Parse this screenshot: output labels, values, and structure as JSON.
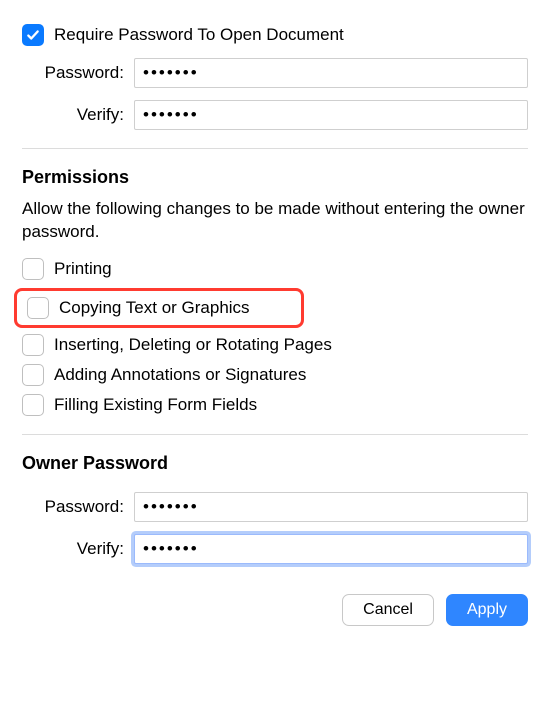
{
  "open_password": {
    "require_label": "Require Password To Open Document",
    "require_checked": true,
    "password_label": "Password:",
    "password_value": "•••••••",
    "verify_label": "Verify:",
    "verify_value": "•••••••"
  },
  "permissions": {
    "title": "Permissions",
    "description": "Allow the following changes to be made without entering the owner password.",
    "items": {
      "printing": "Printing",
      "copying": "Copying Text or Graphics",
      "inserting": "Inserting, Deleting or Rotating Pages",
      "annotations": "Adding Annotations or Signatures",
      "formfields": "Filling Existing Form Fields"
    }
  },
  "owner_password": {
    "title": "Owner Password",
    "password_label": "Password:",
    "password_value": "•••••••",
    "verify_label": "Verify:",
    "verify_value": "•••••••"
  },
  "buttons": {
    "cancel": "Cancel",
    "apply": "Apply"
  }
}
